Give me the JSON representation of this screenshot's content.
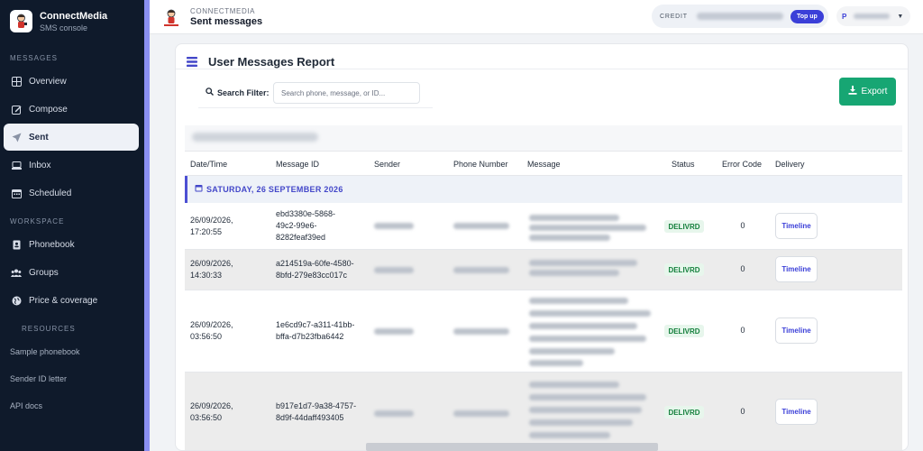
{
  "brand": {
    "title": "ConnectMedia",
    "subtitle": "SMS console"
  },
  "sidebar": {
    "sections": {
      "messages": "MESSAGES",
      "workspace": "WORKSPACE",
      "resources": "RESOURCES"
    },
    "messages_items": [
      {
        "label": "Overview",
        "icon": "grid-icon"
      },
      {
        "label": "Compose",
        "icon": "edit-icon"
      },
      {
        "label": "Sent",
        "icon": "send-icon",
        "active": true
      },
      {
        "label": "Inbox",
        "icon": "inbox-icon"
      },
      {
        "label": "Scheduled",
        "icon": "calendar-icon"
      }
    ],
    "workspace_items": [
      {
        "label": "Phonebook",
        "icon": "address-book-icon"
      },
      {
        "label": "Groups",
        "icon": "users-icon"
      },
      {
        "label": "Price & coverage",
        "icon": "globe-icon"
      }
    ],
    "resources": [
      "Sample phonebook",
      "Sender ID letter",
      "API docs"
    ]
  },
  "header": {
    "kicker": "CONNECTMEDIA",
    "title": "Sent messages",
    "credit_label": "CREDIT",
    "topup_label": "Top up",
    "user_initial": "P"
  },
  "report": {
    "title": "User Messages Report",
    "filter_label": "Search Filter:",
    "search_placeholder": "Search phone, message, or ID...",
    "search_value": "",
    "export_label": "Export",
    "columns": [
      "Date/Time",
      "Message ID",
      "Sender",
      "Phone Number",
      "Message",
      "Status",
      "Error Code",
      "Delivery"
    ],
    "date_band": "SATURDAY, 26 SEPTEMBER 2026",
    "rows": [
      {
        "date": "26/09/2026,",
        "time": "17:20:55",
        "id_lines": [
          "ebd3380e-5868-",
          "49c2-99e6-",
          "8282feaf39ed"
        ],
        "status": "DELIVRD",
        "error": "0",
        "action": "Timeline"
      },
      {
        "date": "26/09/2026,",
        "time": "14:30:33",
        "id_lines": [
          "a214519a-60fe-4580-",
          "8bfd-279e83cc017c"
        ],
        "status": "DELIVRD",
        "error": "0",
        "action": "Timeline"
      },
      {
        "date": "26/09/2026,",
        "time": "03:56:50",
        "id_lines": [
          "1e6cd9c7-a311-41bb-",
          "bffa-d7b23fba6442"
        ],
        "status": "DELIVRD",
        "error": "0",
        "action": "Timeline"
      },
      {
        "date": "26/09/2026,",
        "time": "03:56:50",
        "id_lines": [
          "b917e1d7-9a38-4757-",
          "8d9f-44daff493405"
        ],
        "status": "DELIVRD",
        "error": "0",
        "action": "Timeline"
      }
    ]
  },
  "colors": {
    "accent": "#3b3fd8",
    "export_green": "#17a673",
    "sidebar_bg": "#0f1a2b",
    "status_green": "#15803d"
  }
}
